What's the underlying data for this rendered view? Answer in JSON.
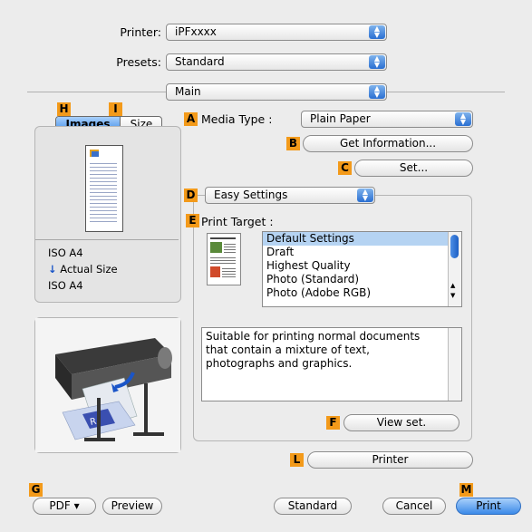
{
  "printer": {
    "label": "Printer:",
    "value": "iPFxxxx"
  },
  "presets": {
    "label": "Presets:",
    "value": "Standard"
  },
  "panel": {
    "value": "Main"
  },
  "view_tabs": {
    "images": "Images",
    "size": "Size"
  },
  "preview": {
    "paper_size": "ISO A4",
    "scale": "Actual Size",
    "output_size": "ISO A4"
  },
  "media_type": {
    "label": "Media Type :",
    "value": "Plain Paper"
  },
  "buttons": {
    "get_info": "Get Information...",
    "set": "Set...",
    "view_set": "View set.",
    "printer": "Printer",
    "pdf": "PDF ▾",
    "preview": "Preview",
    "standard": "Standard",
    "cancel": "Cancel",
    "print": "Print"
  },
  "easy_settings": {
    "value": "Easy Settings"
  },
  "print_target": {
    "label": "Print Target :",
    "items": [
      "Default Settings",
      "Draft",
      "Highest Quality",
      "Photo (Standard)",
      "Photo (Adobe RGB)"
    ],
    "selected_index": 0
  },
  "description": "Suitable for printing normal documents that contain a mixture of text, photographs and graphics.",
  "callouts": {
    "A": "A",
    "B": "B",
    "C": "C",
    "D": "D",
    "E": "E",
    "F": "F",
    "G": "G",
    "H": "H",
    "I": "I",
    "L": "L",
    "M": "M"
  },
  "colors": {
    "accent_blue": "#3b8ae8",
    "callout_orange": "#f39a1a",
    "selection": "#b5d3f2"
  }
}
